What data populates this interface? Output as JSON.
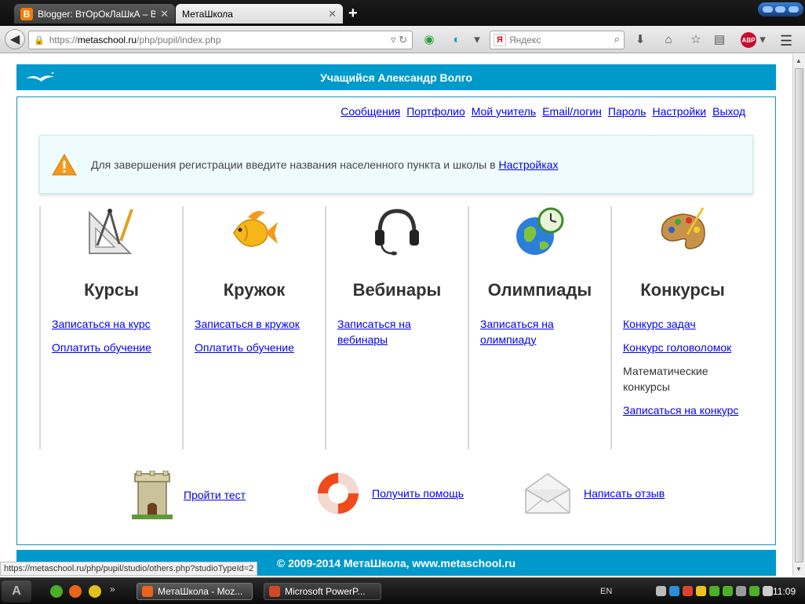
{
  "browser": {
    "tabs": [
      {
        "label": "Blogger: ВтОрОкЛаШкА – В...",
        "active": false
      },
      {
        "label": "МетаШкола",
        "active": true
      }
    ],
    "url_host": "metaschool.ru",
    "url_prefix": "https://",
    "url_path": "/php/pupil/index.php",
    "search_placeholder": "Яндекс",
    "status_url": "https://metaschool.ru/php/pupil/studio/others.php?studioTypeId=2"
  },
  "header": {
    "title": "Учащийся Александр Волго"
  },
  "topnav": [
    "Сообщения",
    "Портфолио",
    "Мой учитель",
    "Email/логин",
    "Пароль",
    "Настройки",
    "Выход"
  ],
  "alert": {
    "text": "Для завершения регистрации введите названия населенного пункта и школы в ",
    "link": "Настройках"
  },
  "columns": [
    {
      "title": "Курсы",
      "icon": "drafting-tools-icon",
      "links": [
        {
          "text": "Записаться на курс",
          "link": true
        },
        {
          "text": "Оплатить обучение",
          "link": true
        }
      ]
    },
    {
      "title": "Кружок",
      "icon": "fish-icon",
      "links": [
        {
          "text": "Записаться в кружок",
          "link": true
        },
        {
          "text": "Оплатить обучение",
          "link": true
        }
      ]
    },
    {
      "title": "Вебинары",
      "icon": "headset-icon",
      "links": [
        {
          "text": "Записаться на вебинары",
          "link": true
        }
      ]
    },
    {
      "title": "Олимпиады",
      "icon": "globe-clock-icon",
      "links": [
        {
          "text": "Записаться на олимпиаду",
          "link": true
        }
      ]
    },
    {
      "title": "Конкурсы",
      "icon": "palette-icon",
      "links": [
        {
          "text": "Конкурс задач",
          "link": true
        },
        {
          "text": "Конкурс головоломок",
          "link": true
        },
        {
          "text": "Математические конкурсы",
          "link": false
        },
        {
          "text": "Записаться на конкурс",
          "link": true
        }
      ]
    }
  ],
  "bottom": [
    {
      "text": "Пройти тест",
      "icon": "castle-tower-icon"
    },
    {
      "text": "Получить помощь",
      "icon": "lifebuoy-icon"
    },
    {
      "text": "Написать отзыв",
      "icon": "envelope-icon"
    }
  ],
  "footer": {
    "text": "© 2009-2014 МетаШкола, www.metaschool.ru"
  },
  "taskbar": {
    "tasks": [
      "МетаШкола - Moz...",
      "Microsoft PowerP..."
    ],
    "lang": "EN",
    "clock": "11:09"
  },
  "colors": {
    "accent": "#0099cc",
    "link": "#0000ee",
    "alert_bg": "#eefcfd"
  }
}
